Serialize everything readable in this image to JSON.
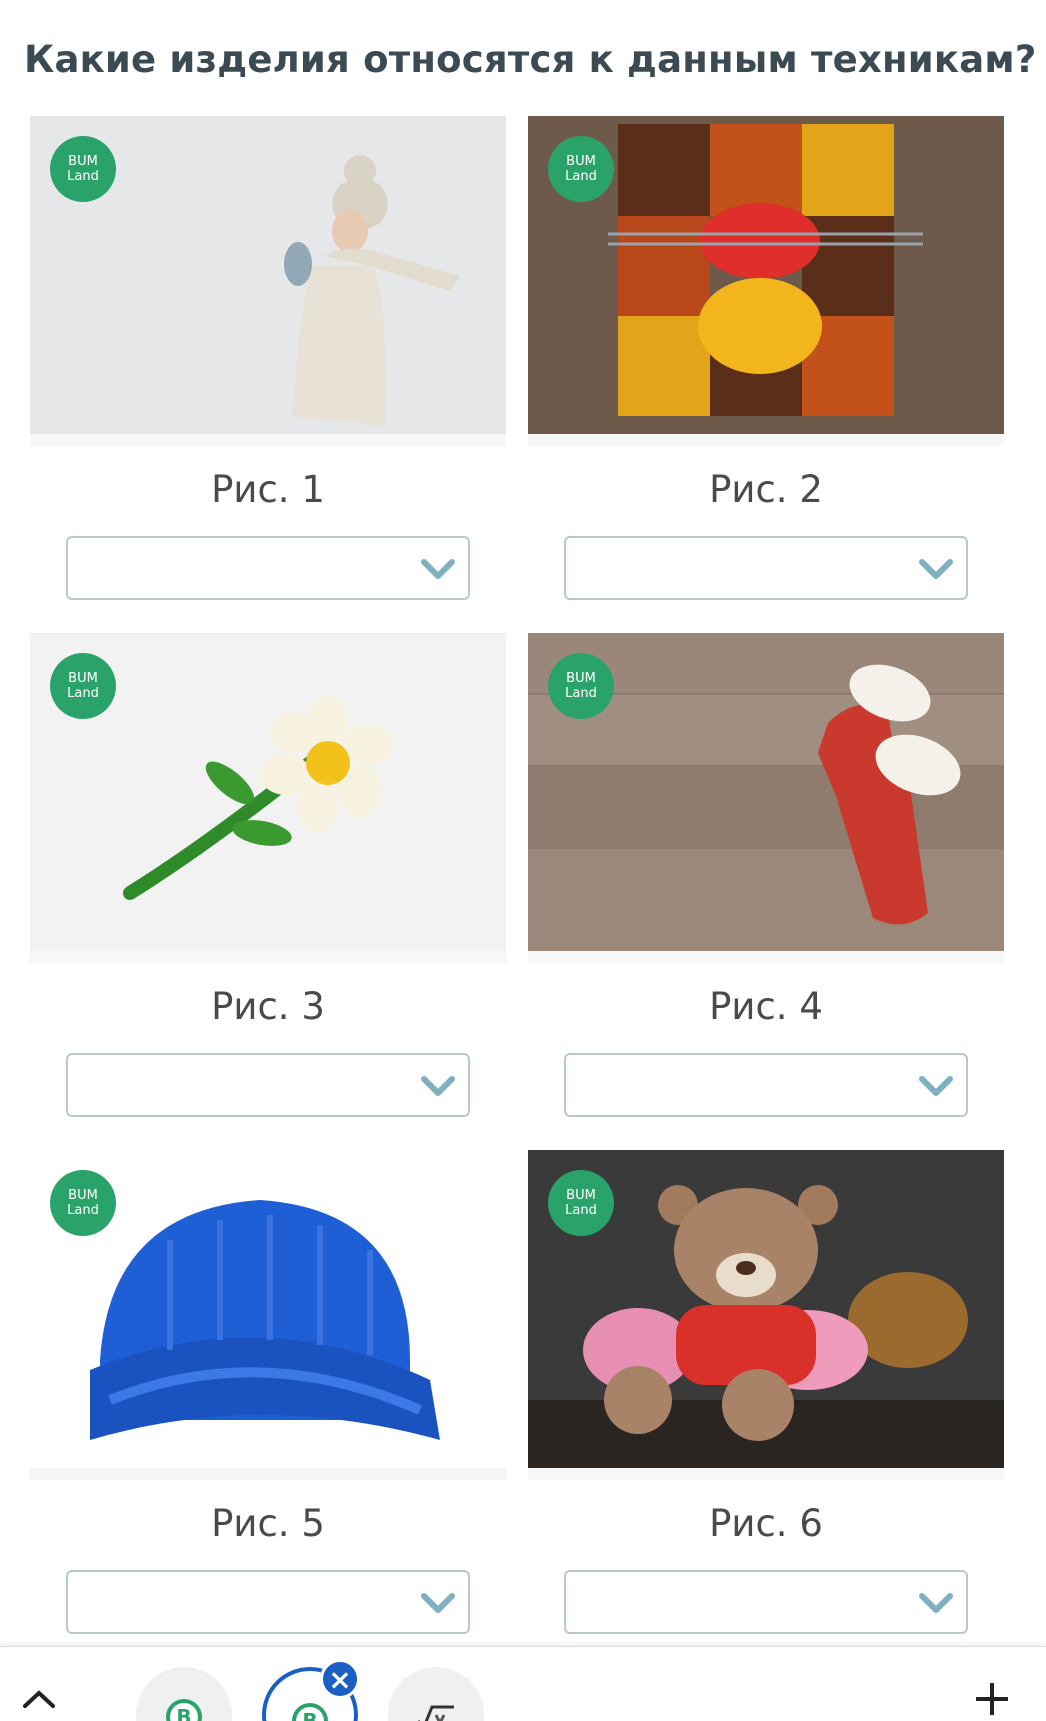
{
  "question": "Какие изделия относятся к данным техникам?",
  "logo_text": [
    "BUM",
    "Land"
  ],
  "items": [
    {
      "caption": "Рис. 1",
      "photo": "woman-in-knitted-hat-scarf-sweater",
      "selected_value": ""
    },
    {
      "caption": "Рис. 2",
      "photo": "crochet-granny-squares-with-yarn",
      "selected_value": ""
    },
    {
      "caption": "Рис. 3",
      "photo": "crochet-daisy-flower",
      "selected_value": ""
    },
    {
      "caption": "Рис. 4",
      "photo": "red-knitted-mittens-on-wood",
      "selected_value": ""
    },
    {
      "caption": "Рис. 5",
      "photo": "blue-knitted-turban-hat",
      "selected_value": ""
    },
    {
      "caption": "Рис. 6",
      "photo": "crochet-teddy-bear-toy",
      "selected_value": ""
    }
  ],
  "colors": {
    "accent_green": "#2aa36b",
    "select_border": "#b7c9cf",
    "chevron": "#7fb0c0",
    "active_tab": "#1a5fc6"
  },
  "bottom_bar": {
    "icons": [
      "chevron-up-icon",
      "tab-icon",
      "active-tab-icon",
      "math-icon",
      "plus-icon"
    ]
  }
}
